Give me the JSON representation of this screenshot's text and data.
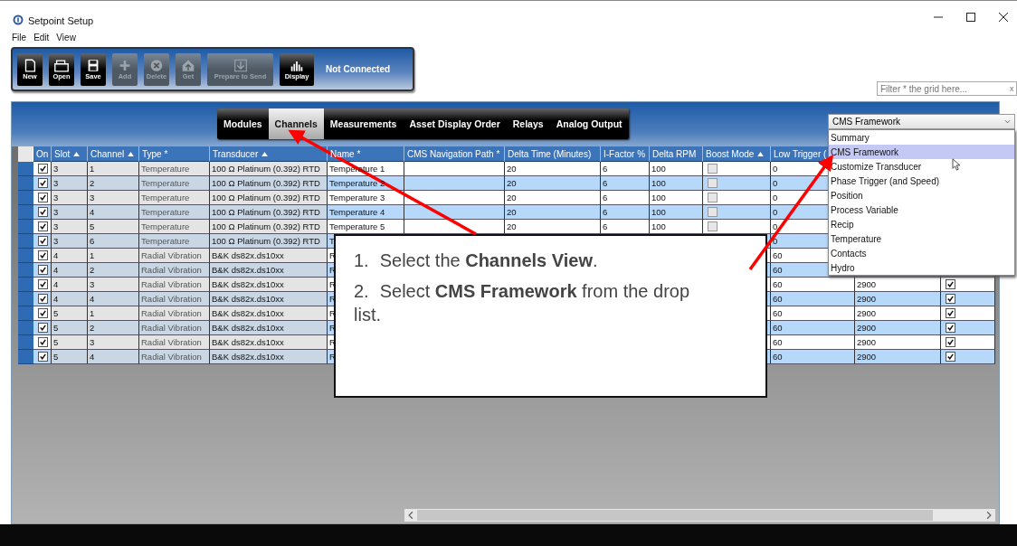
{
  "window": {
    "title": "Setpoint Setup"
  },
  "menu": [
    "File",
    "Edit",
    "View"
  ],
  "toolbar": {
    "buttons": [
      {
        "label": "New",
        "kind": "new",
        "disabled": false
      },
      {
        "label": "Open",
        "kind": "open",
        "disabled": false
      },
      {
        "label": "Save",
        "kind": "save",
        "disabled": false
      },
      {
        "label": "Add",
        "kind": "add",
        "disabled": true
      },
      {
        "label": "Delete",
        "kind": "delete",
        "disabled": true
      },
      {
        "label": "Get",
        "kind": "get",
        "disabled": true
      },
      {
        "label": "Prepare to Send",
        "kind": "send",
        "disabled": true
      },
      {
        "label": "Display",
        "kind": "display",
        "disabled": false
      }
    ],
    "status": "Not Connected"
  },
  "filter": {
    "placeholder": "Filter * the grid here...",
    "clear": "x"
  },
  "tabs": [
    {
      "label": "Modules",
      "selected": false
    },
    {
      "label": "Channels",
      "selected": true
    },
    {
      "label": "Measurements",
      "selected": false
    },
    {
      "label": "Asset Display Order",
      "selected": false
    },
    {
      "label": "Relays",
      "selected": false
    },
    {
      "label": "Analog Output",
      "selected": false
    }
  ],
  "view_select": {
    "value": "CMS Framework",
    "options": [
      {
        "label": "Summary",
        "selected": false
      },
      {
        "label": "CMS Framework",
        "selected": true
      },
      {
        "label": "Customize Transducer",
        "selected": false
      },
      {
        "label": "Phase Trigger (and Speed)",
        "selected": false
      },
      {
        "label": "Position",
        "selected": false
      },
      {
        "label": "Process Variable",
        "selected": false
      },
      {
        "label": "Recip",
        "selected": false
      },
      {
        "label": "Temperature",
        "selected": false
      },
      {
        "label": "Contacts",
        "selected": false
      },
      {
        "label": "Hydro",
        "selected": false
      }
    ]
  },
  "table": {
    "columns": [
      {
        "label": "On"
      },
      {
        "label": "Slot",
        "sorted": true
      },
      {
        "label": "Channel",
        "sorted": true
      },
      {
        "label": "Type *"
      },
      {
        "label": "Transducer",
        "sorted": true
      },
      {
        "label": "Name *"
      },
      {
        "label": "CMS Navigation Path *"
      },
      {
        "label": "Delta Time (Minutes)"
      },
      {
        "label": "I-Factor %"
      },
      {
        "label": "Delta RPM"
      },
      {
        "label": "Boost Mode",
        "sorted": true
      },
      {
        "label": "Low Trigger ("
      }
    ],
    "rows": [
      {
        "on": true,
        "slot": "3",
        "channel": "1",
        "type": "Temperature",
        "transducer": "100 Ω Platinum (0.392) RTD",
        "name": "Temperature 1",
        "delta_time": "20",
        "i_factor": "6",
        "delta_rpm": "100",
        "boost_mode": false,
        "low_trigger": "0"
      },
      {
        "on": true,
        "slot": "3",
        "channel": "2",
        "type": "Temperature",
        "transducer": "100 Ω Platinum (0.392) RTD",
        "name": "Temperature 2",
        "delta_time": "20",
        "i_factor": "6",
        "delta_rpm": "100",
        "boost_mode": false,
        "low_trigger": "0"
      },
      {
        "on": true,
        "slot": "3",
        "channel": "3",
        "type": "Temperature",
        "transducer": "100 Ω Platinum (0.392) RTD",
        "name": "Temperature 3",
        "delta_time": "20",
        "i_factor": "6",
        "delta_rpm": "100",
        "boost_mode": false,
        "low_trigger": "0"
      },
      {
        "on": true,
        "slot": "3",
        "channel": "4",
        "type": "Temperature",
        "transducer": "100 Ω Platinum (0.392) RTD",
        "name": "Temperature 4",
        "delta_time": "20",
        "i_factor": "6",
        "delta_rpm": "100",
        "boost_mode": false,
        "low_trigger": "0"
      },
      {
        "on": true,
        "slot": "3",
        "channel": "5",
        "type": "Temperature",
        "transducer": "100 Ω Platinum (0.392) RTD",
        "name": "Temperature 5",
        "delta_time": "20",
        "i_factor": "6",
        "delta_rpm": "100",
        "boost_mode": false,
        "low_trigger": "0"
      },
      {
        "on": true,
        "slot": "3",
        "channel": "6",
        "type": "Temperature",
        "transducer": "100 Ω Platinum (0.392) RTD",
        "name": "T",
        "low_trigger": "0"
      },
      {
        "on": true,
        "slot": "4",
        "channel": "1",
        "type": "Radial Vibration",
        "transducer": "B&K ds82x.ds10xx",
        "name": "R",
        "low_trigger": "60"
      },
      {
        "on": true,
        "slot": "4",
        "channel": "2",
        "type": "Radial Vibration",
        "transducer": "B&K ds82x.ds10xx",
        "name": "R",
        "low_trigger": "60"
      },
      {
        "on": true,
        "slot": "4",
        "channel": "3",
        "type": "Radial Vibration",
        "transducer": "B&K ds82x.ds10xx",
        "name": "R",
        "low_trigger": "60",
        "column_13": "2900",
        "column_14": true
      },
      {
        "on": true,
        "slot": "4",
        "channel": "4",
        "type": "Radial Vibration",
        "transducer": "B&K ds82x.ds10xx",
        "name": "R",
        "low_trigger": "60",
        "column_13": "2900",
        "column_14": true
      },
      {
        "on": true,
        "slot": "5",
        "channel": "1",
        "type": "Radial Vibration",
        "transducer": "B&K ds82x.ds10xx",
        "name": "R",
        "low_trigger": "60",
        "column_13": "2900",
        "column_14": true
      },
      {
        "on": true,
        "slot": "5",
        "channel": "2",
        "type": "Radial Vibration",
        "transducer": "B&K ds82x.ds10xx",
        "name": "R",
        "low_trigger": "60",
        "column_13": "2900",
        "column_14": true
      },
      {
        "on": true,
        "slot": "5",
        "channel": "3",
        "type": "Radial Vibration",
        "transducer": "B&K ds82x.ds10xx",
        "name": "R",
        "low_trigger": "60",
        "column_13": "2900",
        "column_14": true
      },
      {
        "on": true,
        "slot": "5",
        "channel": "4",
        "type": "Radial Vibration",
        "transducer": "B&K ds82x.ds10xx",
        "name": "R",
        "low_trigger": "60",
        "column_13": "2900",
        "column_14": true
      }
    ]
  },
  "callout": {
    "steps": [
      {
        "number": "1.",
        "text": "Select the **Channels View**."
      },
      {
        "number": "2.",
        "text": "Select **CMS Framework** from the drop list."
      }
    ]
  }
}
